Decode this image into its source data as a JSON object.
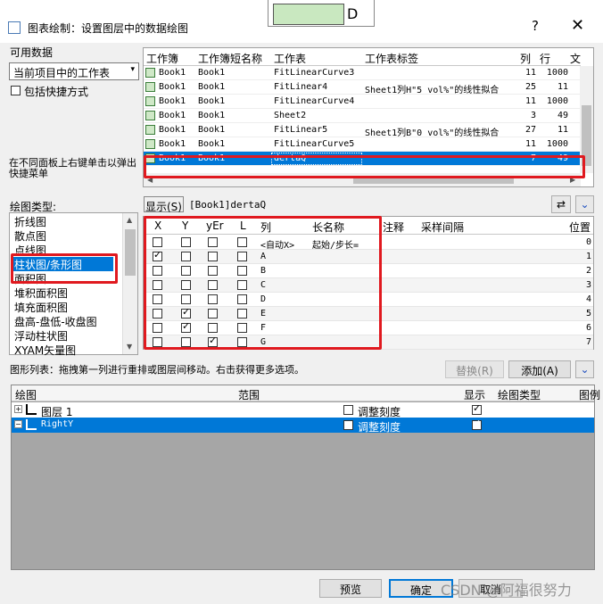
{
  "dialog": {
    "title": "图表绘制：设置图层中的数据绘图",
    "help": "?",
    "close": "✕",
    "bg_letter": "D"
  },
  "left": {
    "available_label": "可用数据",
    "source_select": "当前项目中的工作表",
    "include_shortcut": "包括快捷方式",
    "hint": "在不同面板上右键单击以弹出快捷菜单",
    "plot_type_label": "绘图类型:",
    "plot_types": [
      "折线图",
      "散点图",
      "点线图",
      "柱状图/条形图",
      "面积图",
      "堆积面积图",
      "填充面积图",
      "盘高-盘低-收盘图",
      "浮动柱状图",
      "XYAM矢量图"
    ],
    "selected_plot_type": 3
  },
  "sheets": {
    "headers": [
      "工作簿",
      "工作簿短名称",
      "工作表",
      "工作表标签",
      "列",
      "行",
      "文"
    ],
    "rows": [
      {
        "book": "Book1",
        "short": "Book1",
        "sheet": "FitLinearCurve3",
        "label": "",
        "col": "11",
        "row": "1000"
      },
      {
        "book": "Book1",
        "short": "Book1",
        "sheet": "FitLinear4",
        "label": "Sheet1列H\"5 vol%\"的线性拟合",
        "col": "25",
        "row": "11"
      },
      {
        "book": "Book1",
        "short": "Book1",
        "sheet": "FitLinearCurve4",
        "label": "",
        "col": "11",
        "row": "1000"
      },
      {
        "book": "Book1",
        "short": "Book1",
        "sheet": "Sheet2",
        "label": "",
        "col": "3",
        "row": "49"
      },
      {
        "book": "Book1",
        "short": "Book1",
        "sheet": "FitLinear5",
        "label": "Sheet1列B\"0 vol%\"的线性拟合",
        "col": "27",
        "row": "11"
      },
      {
        "book": "Book1",
        "short": "Book1",
        "sheet": "FitLinearCurve5",
        "label": "",
        "col": "11",
        "row": "1000"
      },
      {
        "book": "Book1",
        "short": "Book1",
        "sheet": "dertaQ",
        "label": "",
        "col": "7",
        "row": "49"
      }
    ],
    "selected_row": 6
  },
  "show_bar": {
    "button": "显示(S)",
    "path": "[Book1]dertaQ"
  },
  "columns": {
    "headers": [
      "X",
      "Y",
      "yEr",
      "L",
      "列",
      "长名称",
      "注释",
      "采样间隔",
      "位置"
    ],
    "rows": [
      {
        "x": false,
        "y": false,
        "yer": false,
        "l": false,
        "col": "<自动X>",
        "lname": "起始/步长=",
        "pos": "0"
      },
      {
        "x": true,
        "y": false,
        "yer": false,
        "l": false,
        "col": "A",
        "lname": "",
        "pos": "1"
      },
      {
        "x": false,
        "y": false,
        "yer": false,
        "l": false,
        "col": "B",
        "lname": "",
        "pos": "2"
      },
      {
        "x": false,
        "y": false,
        "yer": false,
        "l": false,
        "col": "C",
        "lname": "",
        "pos": "3"
      },
      {
        "x": false,
        "y": false,
        "yer": false,
        "l": false,
        "col": "D",
        "lname": "",
        "pos": "4"
      },
      {
        "x": false,
        "y": true,
        "yer": false,
        "l": false,
        "col": "E",
        "lname": "",
        "pos": "5"
      },
      {
        "x": false,
        "y": true,
        "yer": false,
        "l": false,
        "col": "F",
        "lname": "",
        "pos": "6"
      },
      {
        "x": false,
        "y": false,
        "yer": true,
        "l": false,
        "col": "G",
        "lname": "",
        "pos": "7"
      }
    ]
  },
  "plot_list": {
    "label": "图形列表：拖拽第一列进行重排或图层间移动。右击获得更多选项。",
    "replace": "替换(R)",
    "add": "添加(A)",
    "headers": [
      "绘图",
      "范围",
      "显示",
      "绘图类型",
      "图例"
    ],
    "rows": [
      {
        "name": "图层 1",
        "adjust": "调整刻度",
        "show": true,
        "selected": false
      },
      {
        "name": "RightY",
        "adjust": "调整刻度",
        "show": true,
        "selected": true
      }
    ]
  },
  "footer": {
    "preview": "预览",
    "ok": "确定",
    "cancel": "取消",
    "watermark": "CSDN @阿福很努力"
  }
}
